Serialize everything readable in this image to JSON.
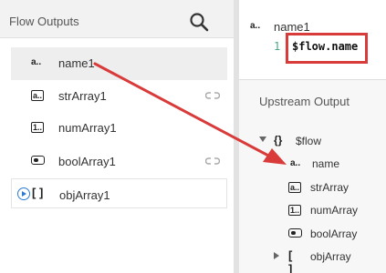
{
  "left_panel": {
    "title": "Flow Outputs",
    "items": [
      {
        "type_glyph": "a..",
        "label": "name1"
      },
      {
        "type_glyph": "[a..]",
        "label": "strArray1"
      },
      {
        "type_glyph": "[1..]",
        "label": "numArray1"
      },
      {
        "type_glyph": "bool",
        "label": "boolArray1"
      },
      {
        "type_glyph": "[ ]",
        "label": "objArray1"
      }
    ]
  },
  "editor": {
    "type_glyph": "a..",
    "field_name": "name1",
    "line_number": "1",
    "expression": "$flow.name"
  },
  "upstream": {
    "title": "Upstream Output",
    "root": {
      "type_glyph": "{}",
      "label": "$flow"
    },
    "children": [
      {
        "type_glyph": "a..",
        "label": "name"
      },
      {
        "type_glyph": "[a..]",
        "label": "strArray"
      },
      {
        "type_glyph": "[1..]",
        "label": "numArray"
      },
      {
        "type_glyph": "bool",
        "label": "boolArray"
      },
      {
        "type_glyph": "[ ]",
        "label": "objArray"
      }
    ]
  },
  "colors": {
    "highlight_red": "#d93a3a",
    "expand_blue": "#2a7bd3"
  }
}
